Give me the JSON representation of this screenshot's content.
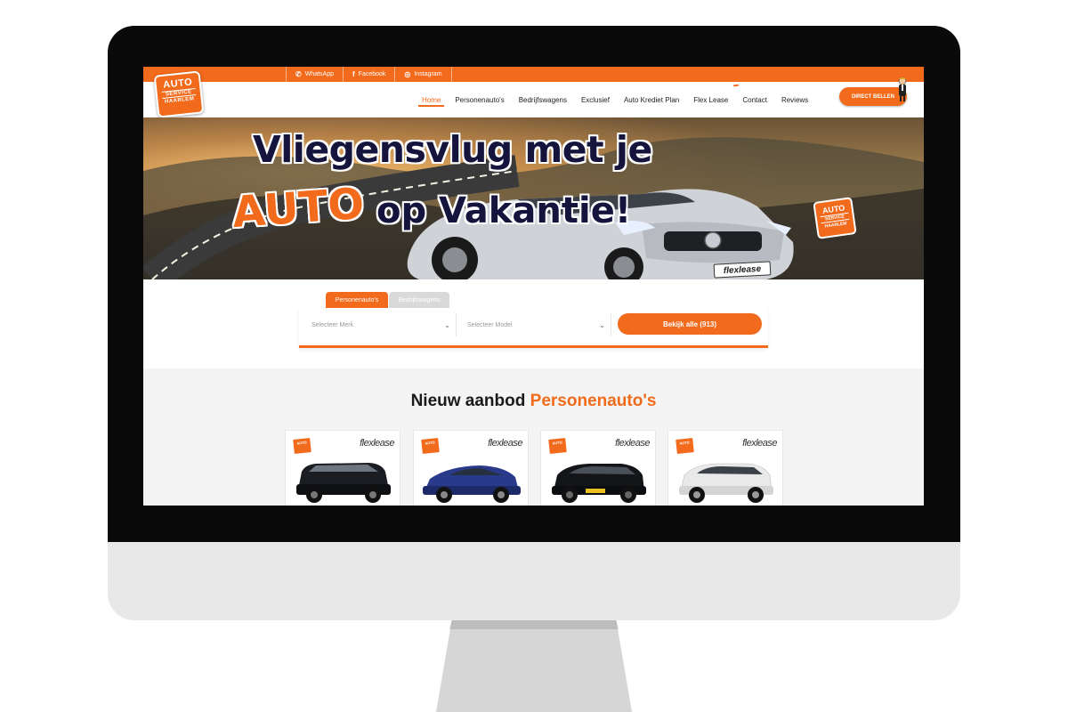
{
  "social": [
    "WhatsApp",
    "Facebook",
    "Instagram"
  ],
  "logo": {
    "line1": "AUTO",
    "line2": "SERVICE",
    "line3": "HAARLEM"
  },
  "nav": {
    "items": [
      "Home",
      "Personenauto's",
      "Bedrijfswagens",
      "Exclusief",
      "Auto Krediet Plan",
      "Flex Lease",
      "Contact",
      "Reviews"
    ],
    "active": "Home",
    "cta": "DIRECT BELLEN"
  },
  "hero": {
    "line1": "Vliegensvlug met je",
    "line2a": "AUTO",
    "line2b": "op Vakantie!",
    "plate": "flexlease"
  },
  "search": {
    "tabs": [
      "Personenauto's",
      "Bedrijfswagens"
    ],
    "select_brand": "Selecteer Merk",
    "select_model": "Selecteer Model",
    "button": "Bekijk alle (913)"
  },
  "listing": {
    "title_a": "Nieuw aanbod",
    "title_b": "Personenauto's",
    "card_brand": "flexlease"
  },
  "colors": {
    "accent": "#f26a1b",
    "dark": "#14143c"
  }
}
